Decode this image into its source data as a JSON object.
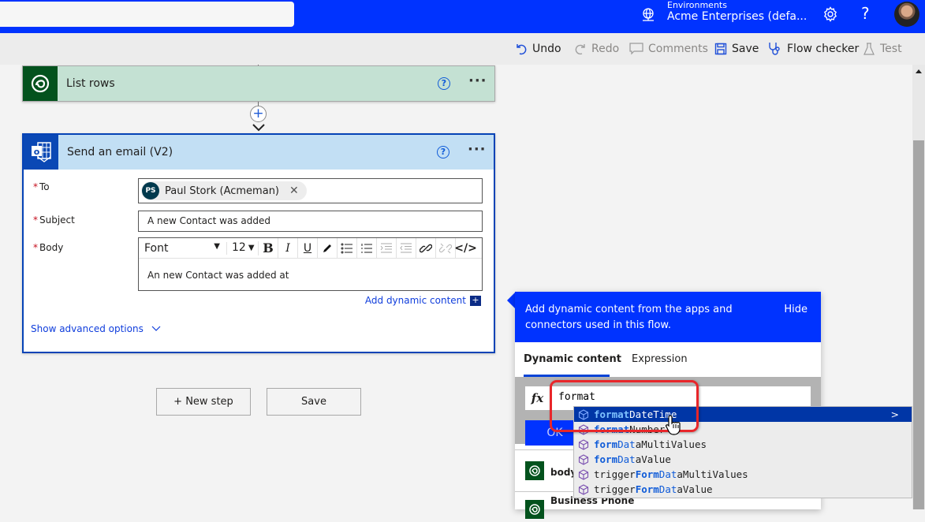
{
  "header": {
    "environment_label": "Environments",
    "environment_name": "Acme Enterprises (defa...",
    "help_glyph": "?",
    "brand_color": "#0033ff"
  },
  "commands": {
    "undo": "Undo",
    "redo": "Redo",
    "comments": "Comments",
    "save": "Save",
    "flow_checker": "Flow checker",
    "test": "Test"
  },
  "flow": {
    "list_rows": {
      "title": "List rows"
    },
    "send_email": {
      "title": "Send an email (V2)",
      "fields": {
        "to_label": "To",
        "to_recipient_initials": "PS",
        "to_recipient_name": "Paul Stork (Acmeman)",
        "subject_label": "Subject",
        "subject_value": "A new Contact was added",
        "body_label": "Body",
        "body_value": "An new Contact was added at",
        "required_mark": "*"
      },
      "editor_toolbar": {
        "font": "Font",
        "size": "12",
        "bold": "B",
        "italic": "I",
        "underline": "U",
        "code": "</>"
      },
      "add_dynamic_content": "Add dynamic content",
      "show_advanced_options": "Show advanced options"
    },
    "new_step_label": "+ New step",
    "save_label": "Save"
  },
  "dynamic_panel": {
    "message": "Add dynamic content from the apps and connectors used in this flow.",
    "hide_label": "Hide",
    "tabs": [
      {
        "label": "Dynamic content",
        "active": true
      },
      {
        "label": "Expression",
        "active": false
      }
    ],
    "fx_label": "fx",
    "expression_value": "format",
    "ok_label": "OK",
    "items": [
      {
        "label": "body"
      },
      {
        "label": "Business Phone"
      }
    ]
  },
  "autocomplete": {
    "items": [
      {
        "pre": "",
        "hl": "format",
        "hl2": "",
        "rest": "DateTime",
        "selected": true
      },
      {
        "pre": "",
        "hl": "format",
        "hl2": "",
        "rest": "Number",
        "selected": false
      },
      {
        "pre": "",
        "hl": "form",
        "hl2": "Dat",
        "rest": "aMultiValues",
        "selected": false
      },
      {
        "pre": "",
        "hl": "form",
        "hl2": "Dat",
        "rest": "aValue",
        "selected": false
      },
      {
        "pre": "trigger",
        "hl": "Form",
        "hl2": "Dat",
        "rest": "aMultiValues",
        "selected": false
      },
      {
        "pre": "trigger",
        "hl": "Form",
        "hl2": "Dat",
        "rest": "aValue",
        "selected": false
      }
    ],
    "selected_chevron": ">"
  }
}
